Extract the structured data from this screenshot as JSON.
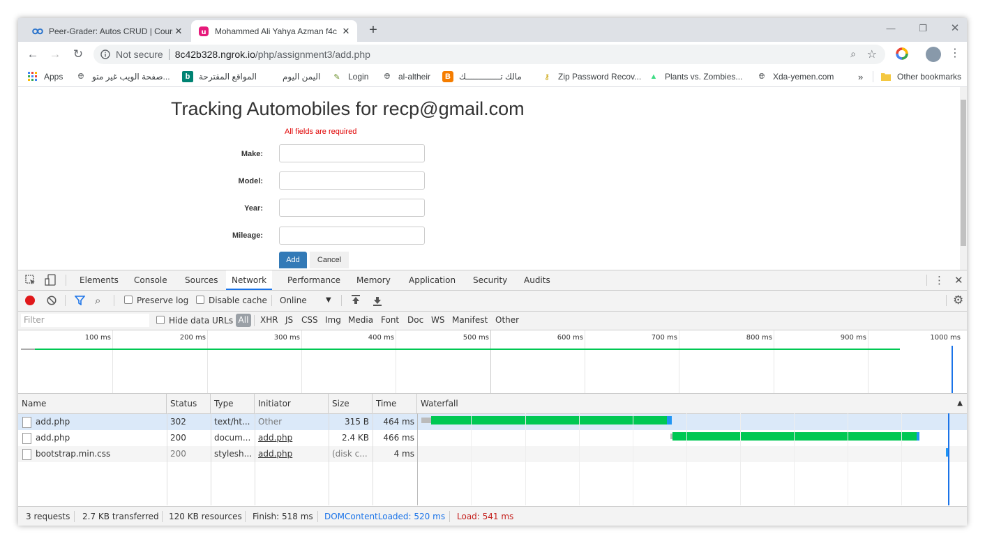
{
  "browser": {
    "tabs": [
      {
        "title": "Peer-Grader: Autos CRUD | Cours",
        "favicon": "coursera-icon"
      },
      {
        "title": "Mohammed Ali Yahya Azman f4c",
        "favicon": "ngrok-icon"
      }
    ],
    "new_tab_label": "+",
    "security_label": "Not secure",
    "url_host": "8c42b328.ngrok.io",
    "url_path": "/php/assignment3/add.php",
    "bookmarks": [
      {
        "label": "Apps",
        "icon": "apps-grid-icon"
      },
      {
        "label": "صفحة الويب غير متو...",
        "icon": "globe-icon"
      },
      {
        "label": "المواقع المقترحة",
        "icon": "bing-icon"
      },
      {
        "label": "اليمن اليوم",
        "icon": ""
      },
      {
        "label": "Login",
        "icon": "login-icon"
      },
      {
        "label": "al-altheir",
        "icon": "globe-icon"
      },
      {
        "label": "مالك تــــــــــــــك",
        "icon": "blogger-icon"
      },
      {
        "label": "Zip Password Recov...",
        "icon": "key-icon"
      },
      {
        "label": "Plants vs. Zombies...",
        "icon": "android-icon"
      },
      {
        "label": "Xda-yemen.com",
        "icon": "globe-icon"
      }
    ],
    "more_bookmarks": "»",
    "other_bookmarks": "Other bookmarks"
  },
  "page": {
    "title": "Tracking Automobiles for recp@gmail.com",
    "error": "All fields are required",
    "fields": [
      {
        "label": "Make:",
        "value": ""
      },
      {
        "label": "Model:",
        "value": ""
      },
      {
        "label": "Year:",
        "value": ""
      },
      {
        "label": "Mileage:",
        "value": ""
      }
    ],
    "add_button": "Add",
    "cancel_button": "Cancel"
  },
  "devtools": {
    "tabs": [
      "Elements",
      "Console",
      "Sources",
      "Network",
      "Performance",
      "Memory",
      "Application",
      "Security",
      "Audits"
    ],
    "active_tab": "Network",
    "preserve_log": "Preserve log",
    "disable_cache": "Disable cache",
    "throttle": "Online",
    "filter_placeholder": "Filter",
    "hide_data_urls": "Hide data URLs",
    "type_filters": [
      "All",
      "XHR",
      "JS",
      "CSS",
      "Img",
      "Media",
      "Font",
      "Doc",
      "WS",
      "Manifest",
      "Other"
    ],
    "timeline_ticks": [
      "100 ms",
      "200 ms",
      "300 ms",
      "400 ms",
      "500 ms",
      "600 ms",
      "700 ms",
      "800 ms",
      "900 ms",
      "1000 ms"
    ],
    "columns": [
      "Name",
      "Status",
      "Type",
      "Initiator",
      "Size",
      "Time",
      "Waterfall"
    ],
    "rows": [
      {
        "name": "add.php",
        "status": "302",
        "type": "text/ht...",
        "initiator": "Other",
        "size": "315 B",
        "time": "464 ms"
      },
      {
        "name": "add.php",
        "status": "200",
        "type": "docum...",
        "initiator": "add.php",
        "size": "2.4 KB",
        "time": "466 ms"
      },
      {
        "name": "bootstrap.min.css",
        "status": "200",
        "type": "stylesh...",
        "initiator": "add.php",
        "size": "(disk c...",
        "time": "4 ms"
      }
    ],
    "status": {
      "requests": "3 requests",
      "transferred": "2.7 KB transferred",
      "resources": "120 KB resources",
      "finish": "Finish: 518 ms",
      "dcl": "DOMContentLoaded: 520 ms",
      "load": "Load: 541 ms"
    },
    "colors": {
      "waiting": "#00c853",
      "download": "#2196f3",
      "dcl": "#1a73e8",
      "load": "#c5221f"
    }
  }
}
